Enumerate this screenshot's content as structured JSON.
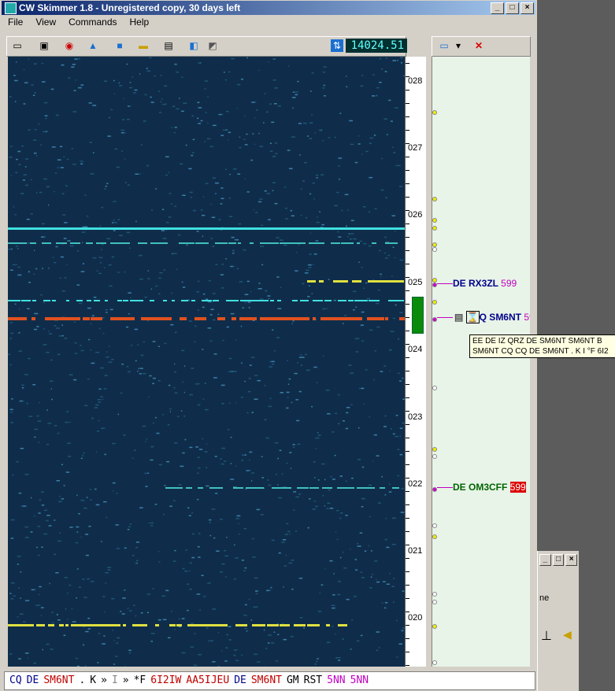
{
  "window": {
    "title": "CW Skimmer 1.8 - Unregistered copy, 30 days left"
  },
  "menu": [
    "File",
    "View",
    "Commands",
    "Help"
  ],
  "toolbar": {
    "frequency": "14024.51"
  },
  "scale": {
    "labels": [
      "028",
      "027",
      "026",
      "025",
      "024",
      "023",
      "022",
      "021",
      "020"
    ]
  },
  "spots": [
    {
      "text": "DE RX3ZL",
      "rst": "599",
      "color": "#00008b"
    },
    {
      "text": "Q SM6NT",
      "rst": "59",
      "color": "#00008b"
    },
    {
      "text": "DE OM3CFF",
      "rst": "599",
      "color": "#006400"
    }
  ],
  "tooltip": {
    "line1": "EE DE IZ QRZ DE SM6NT SM6NT B",
    "line2": "SM6NT CQ CQ DE SM6NT . K I °F 6I2"
  },
  "decode": [
    {
      "t": "CQ",
      "c": "#00008b"
    },
    {
      "t": "DE",
      "c": "#00008b"
    },
    {
      "t": "SM6NT",
      "c": "#c00000"
    },
    {
      "t": ".",
      "c": "#000"
    },
    {
      "t": "K",
      "c": "#000"
    },
    {
      "t": "»",
      "c": "#000"
    },
    {
      "t": "I",
      "c": "#888"
    },
    {
      "t": "»",
      "c": "#000"
    },
    {
      "t": "*F",
      "c": "#000"
    },
    {
      "t": "6I2IW",
      "c": "#c00000"
    },
    {
      "t": "AA5IJEU",
      "c": "#c00000"
    },
    {
      "t": "DE",
      "c": "#00008b"
    },
    {
      "t": "SM6NT",
      "c": "#c00000"
    },
    {
      "t": "GM",
      "c": "#000"
    },
    {
      "t": "RST",
      "c": "#000"
    },
    {
      "t": "5NN",
      "c": "#c000c0"
    },
    {
      "t": "5NN",
      "c": "#c000c0"
    }
  ],
  "colors": {
    "waterfall_bg": "#0f2d4a",
    "signal_cyan": "#40e0e0",
    "signal_red": "#e05020",
    "signal_yellow": "#e0e040"
  }
}
